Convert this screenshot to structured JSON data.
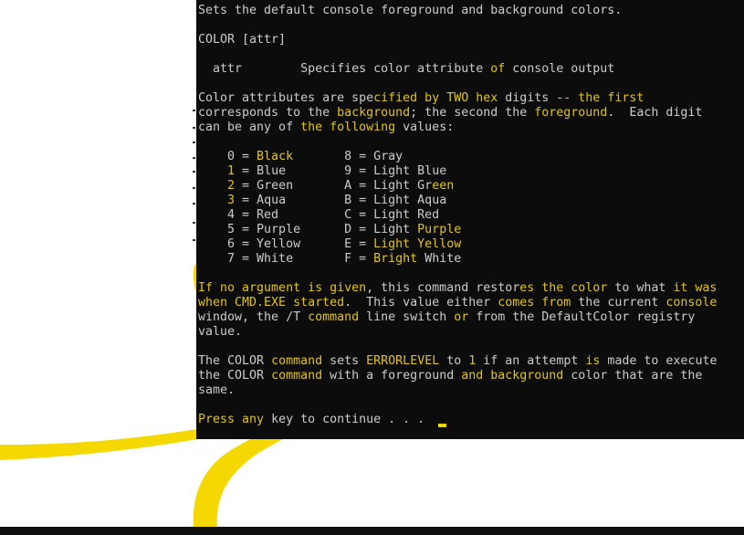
{
  "console": {
    "lines": [
      [
        [
          "Sets the default console foreground and background colors.",
          false
        ]
      ],
      [],
      [
        [
          "COLOR [attr]",
          false
        ]
      ],
      [],
      [
        [
          "  attr        Specifies color attribute ",
          false
        ],
        [
          "of",
          true
        ],
        [
          " console output",
          false
        ]
      ],
      [],
      [
        [
          "Color attributes are spe",
          false
        ],
        [
          "cified by TWO hex",
          true
        ],
        [
          " digits -- ",
          false
        ],
        [
          "the first",
          true
        ]
      ],
      [
        [
          "corresponds to the ",
          false
        ],
        [
          "background",
          true
        ],
        [
          "; the second the ",
          false
        ],
        [
          "foreground",
          true
        ],
        [
          ".  Each digit",
          false
        ]
      ],
      [
        [
          "can be any of ",
          false
        ],
        [
          "the following",
          true
        ],
        [
          " values:",
          false
        ]
      ],
      [],
      [
        [
          "    0 = ",
          false
        ],
        [
          "Black",
          true
        ],
        [
          "       8 = Gray",
          false
        ]
      ],
      [
        [
          "    ",
          false
        ],
        [
          "1",
          true
        ],
        [
          " = Blue        9 = Light Blue",
          false
        ]
      ],
      [
        [
          "    ",
          false
        ],
        [
          "2",
          true
        ],
        [
          " = Green       A = Light Gr",
          false
        ],
        [
          "een",
          true
        ]
      ],
      [
        [
          "    ",
          false
        ],
        [
          "3",
          true
        ],
        [
          " = Aqua        B = Light Aqua",
          false
        ]
      ],
      [
        [
          "    4 = Red         C = Light Red",
          false
        ]
      ],
      [
        [
          "    5 = Purple      D = Light ",
          false
        ],
        [
          "Purple",
          true
        ]
      ],
      [
        [
          "    6 = Yellow      E = ",
          false
        ],
        [
          "Light Yellow",
          true
        ]
      ],
      [
        [
          "    7 = White       F = ",
          false
        ],
        [
          "Bright",
          true
        ],
        [
          " White",
          false
        ]
      ],
      [],
      [
        [
          "If no argument is given",
          true
        ],
        [
          ", this command restor",
          false
        ],
        [
          "es the color",
          true
        ],
        [
          " to what ",
          false
        ],
        [
          "it was",
          true
        ]
      ],
      [
        [
          "when CMD.EXE started",
          true
        ],
        [
          ".  This value either ",
          false
        ],
        [
          "comes from",
          true
        ],
        [
          " the current ",
          false
        ],
        [
          "console",
          true
        ]
      ],
      [
        [
          "window, the /T ",
          false
        ],
        [
          "command",
          true
        ],
        [
          " line switch ",
          false
        ],
        [
          "or",
          true
        ],
        [
          " from the DefaultColor registry",
          false
        ]
      ],
      [
        [
          "value.",
          false
        ]
      ],
      [],
      [
        [
          "The COLOR ",
          false
        ],
        [
          "command",
          true
        ],
        [
          " sets ",
          false
        ],
        [
          "ERRORLEVEL",
          true
        ],
        [
          " to ",
          false
        ],
        [
          "1",
          true
        ],
        [
          " if an attempt ",
          false
        ],
        [
          "is",
          true
        ],
        [
          " made to execute",
          false
        ]
      ],
      [
        [
          "the COLOR ",
          false
        ],
        [
          "command",
          true
        ],
        [
          " with a foreground ",
          false
        ],
        [
          "and background",
          true
        ],
        [
          " color that are the",
          false
        ]
      ],
      [
        [
          "same.",
          false
        ]
      ],
      [],
      [
        [
          "Press any",
          true
        ],
        [
          " key to continue . . .",
          false
        ]
      ]
    ]
  }
}
